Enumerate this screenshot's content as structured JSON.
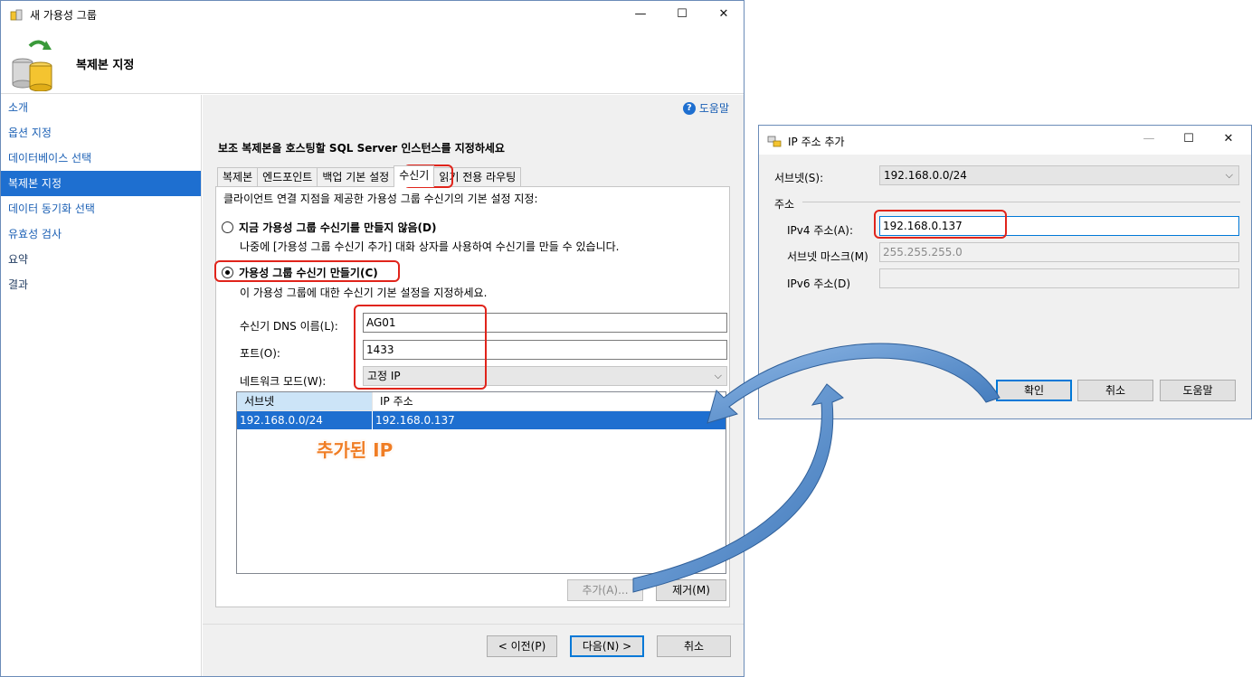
{
  "main_window": {
    "title": "새 가용성 그룹",
    "controls": {
      "minimize": "—",
      "maximize": "☐",
      "close": "✕"
    },
    "page_title": "복제본 지정",
    "sidebar": [
      {
        "label": "소개"
      },
      {
        "label": "옵션 지정"
      },
      {
        "label": "데이터베이스 선택"
      },
      {
        "label": "복제본 지정"
      },
      {
        "label": "데이터 동기화 선택"
      },
      {
        "label": "유효성 검사"
      },
      {
        "label": "요약"
      },
      {
        "label": "결과"
      }
    ],
    "help_label": "도움말",
    "section_title": "보조 복제본을 호스팅할 SQL Server 인스턴스를 지정하세요",
    "tabs": [
      {
        "label": "복제본"
      },
      {
        "label": "엔드포인트"
      },
      {
        "label": "백업 기본 설정"
      },
      {
        "label": "수신기"
      },
      {
        "label": "읽기 전용 라우팅"
      }
    ],
    "panel_description": "클라이언트 연결 지점을 제공한 가용성 그룹 수신기의 기본 설정 지정:",
    "option_no_listener": {
      "label": "지금 가용성 그룹 수신기를 만들지 않음(D)",
      "description": "나중에 [가용성 그룹 수신기 추가] 대화 상자를 사용하여 수신기를 만들 수 있습니다."
    },
    "option_create_listener": {
      "label": "가용성 그룹 수신기 만들기(C)",
      "description": "이 가용성 그룹에 대한 수신기 기본 설정을 지정하세요."
    },
    "fields": {
      "dns_label": "수신기 DNS 이름(L):",
      "dns_value": "AG01",
      "port_label": "포트(O):",
      "port_value": "1433",
      "network_label": "네트워크 모드(W):",
      "network_value": "고정 IP"
    },
    "ip_table": {
      "headers": [
        "서브넷",
        "IP 주소"
      ],
      "rows": [
        {
          "subnet": "192.168.0.0/24",
          "ip": "192.168.0.137"
        }
      ]
    },
    "annotation": "추가된 IP",
    "add_button": "추가(A)...",
    "remove_button": "제거(M)",
    "footer": {
      "prev": "< 이전(P)",
      "next": "다음(N) >",
      "cancel": "취소"
    }
  },
  "ip_dialog": {
    "title": "IP 주소 추가",
    "controls": {
      "minimize": "—",
      "maximize": "☐",
      "close": "✕"
    },
    "subnet_label": "서브넷(S):",
    "subnet_value": "192.168.0.0/24",
    "address_group": "주소",
    "ipv4_label": "IPv4 주소(A):",
    "ipv4_value": "192.168.0.137",
    "mask_label": "서브넷 마스크(M)",
    "mask_value": "255.255.255.0",
    "ipv6_label": "IPv6 주소(D)",
    "ipv6_value": "",
    "ok": "확인",
    "cancel": "취소",
    "help": "도움말"
  },
  "colors": {
    "accent": "#1e6fd0",
    "annotation_red": "#e0241b",
    "annotation_orange": "#f07d24",
    "arrow_blue": "#4a86c8"
  }
}
